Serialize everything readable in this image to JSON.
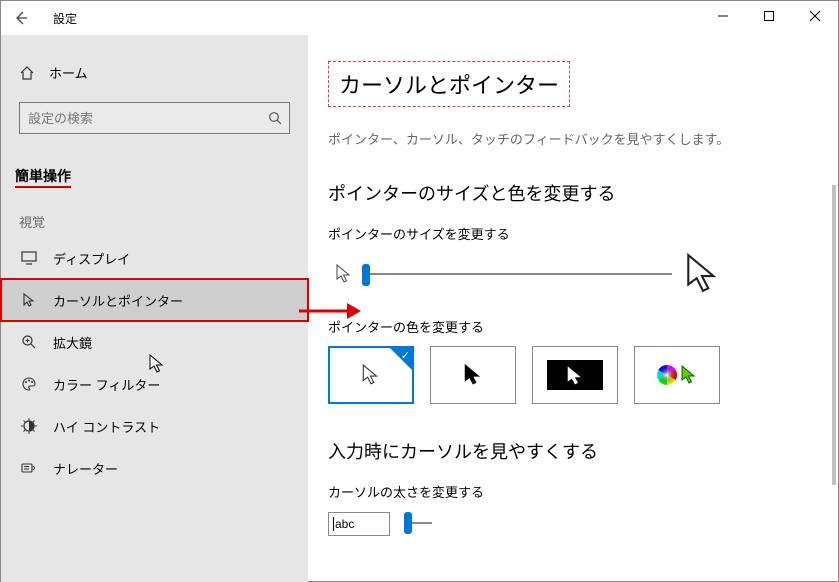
{
  "titlebar": {
    "title": "設定"
  },
  "sidebar": {
    "home": "ホーム",
    "search_placeholder": "設定の検索",
    "section_header": "簡単操作",
    "group_visual": "視覚",
    "items": [
      {
        "label": "ディスプレイ"
      },
      {
        "label": "カーソルとポインター"
      },
      {
        "label": "拡大鏡"
      },
      {
        "label": "カラー フィルター"
      },
      {
        "label": "ハイ コントラスト"
      },
      {
        "label": "ナレーター"
      }
    ]
  },
  "content": {
    "page_title": "カーソルとポインター",
    "description": "ポインター、カーソル、タッチのフィードバックを見やすくします。",
    "size_color_heading": "ポインターのサイズと色を変更する",
    "size_label": "ポインターのサイズを変更する",
    "color_label": "ポインターの色を変更する",
    "input_visibility_heading": "入力時にカーソルを見やすくする",
    "thickness_label": "カーソルの太さを変更する",
    "abc_sample": "abc"
  },
  "colors": {
    "accent": "#0078d7",
    "annotation": "#d00"
  }
}
